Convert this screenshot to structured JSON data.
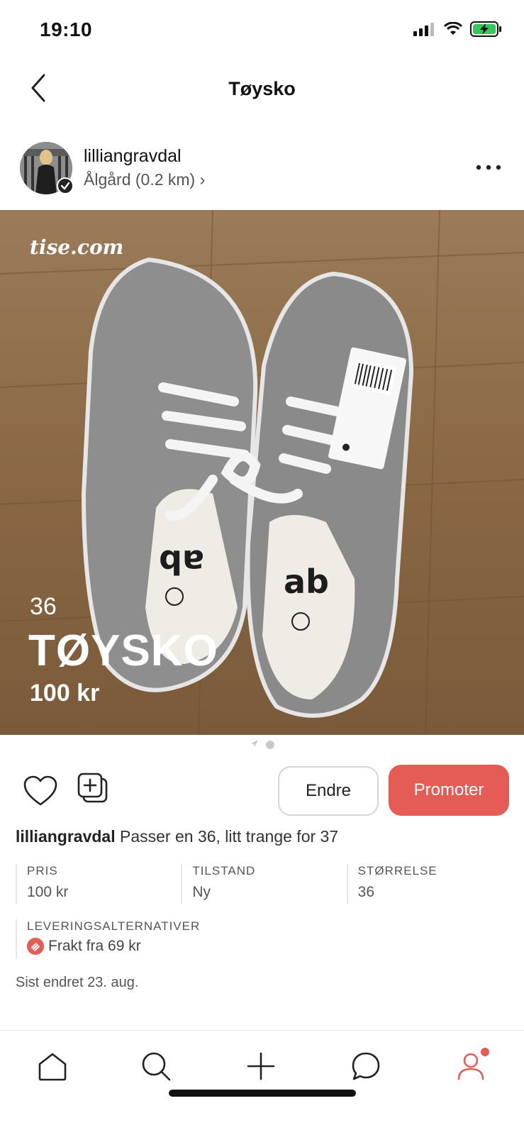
{
  "status_bar": {
    "time": "19:10",
    "signal_icon": "cellular-signal-icon",
    "wifi_icon": "wifi-icon",
    "battery_icon": "battery-charging-icon"
  },
  "header": {
    "title": "Tøysko",
    "back_icon": "chevron-left-icon"
  },
  "seller": {
    "username": "lilliangravdal",
    "location": "Ålgård (0.2 km) ›",
    "more_icon": "more-horizontal-icon"
  },
  "image": {
    "watermark": "tise.com",
    "overlay_size": "36",
    "overlay_title": "TØYSKO",
    "overlay_price": "100 kr"
  },
  "actions": {
    "like_icon": "heart-icon",
    "save_icon": "add-to-collection-icon",
    "edit_label": "Endre",
    "promote_label": "Promoter"
  },
  "description": {
    "username": "lilliangravdal",
    "text": " Passer en 36, litt trange for 37"
  },
  "details": [
    {
      "label": "PRIS",
      "value": "100 kr"
    },
    {
      "label": "TILSTAND",
      "value": "Ny"
    },
    {
      "label": "STØRRELSE",
      "value": "36"
    }
  ],
  "delivery": {
    "label": "LEVERINGSALTERNATIVER",
    "value": "Frakt fra 69 kr",
    "icon": "shipping-icon"
  },
  "last_edited": "Sist endret 23. aug.",
  "tab_bar": {
    "items": [
      "home-icon",
      "search-icon",
      "plus-icon",
      "chat-icon",
      "profile-icon"
    ]
  },
  "colors": {
    "accent": "#e45c55",
    "battery": "#34c759"
  }
}
